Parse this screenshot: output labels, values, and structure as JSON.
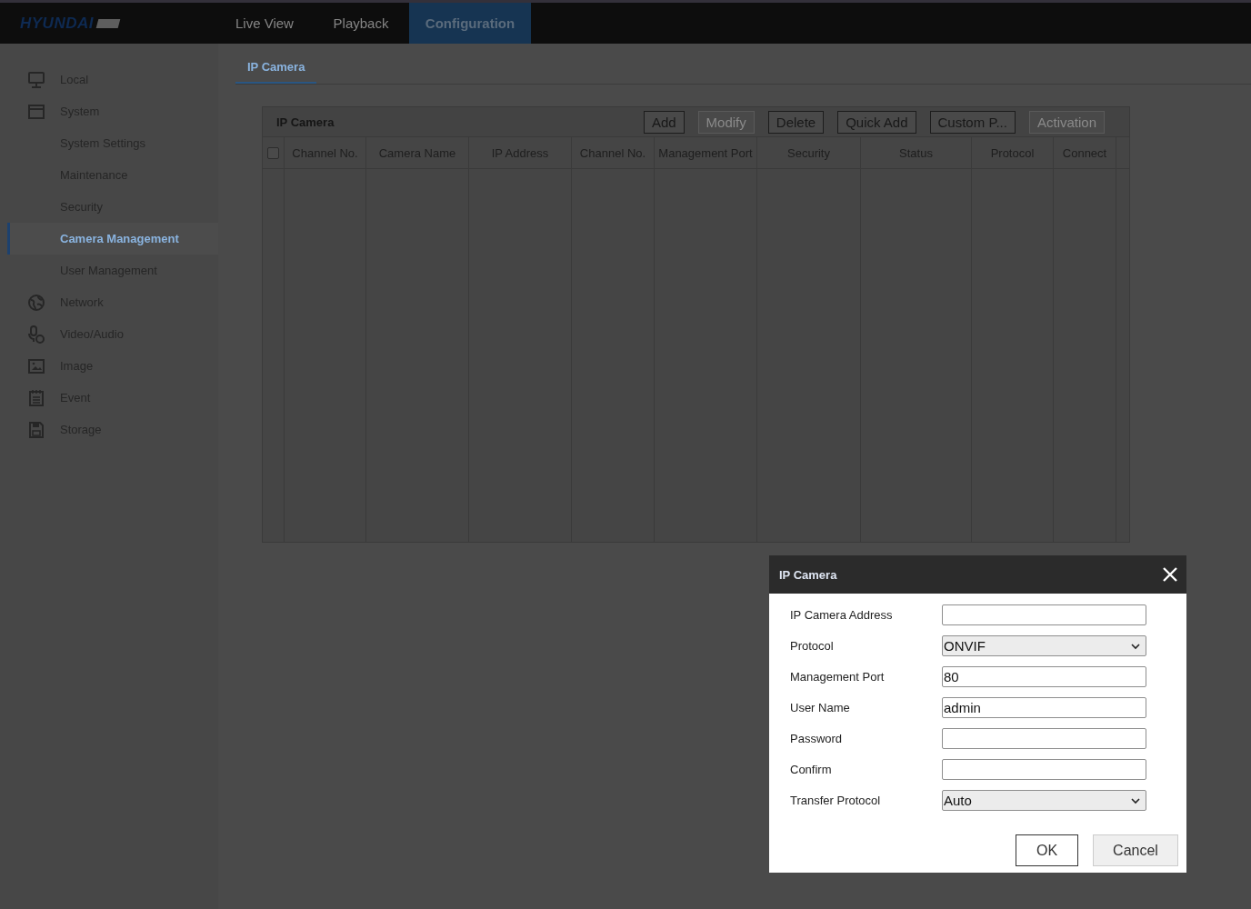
{
  "header": {
    "logo": "HYUNDAI",
    "nav": [
      {
        "label": "Live View",
        "selected": false
      },
      {
        "label": "Playback",
        "selected": false
      },
      {
        "label": "Configuration",
        "selected": true
      }
    ]
  },
  "sidebar": {
    "items": [
      {
        "label": "Local",
        "selected": false
      },
      {
        "label": "System",
        "selected": false,
        "children": [
          {
            "label": "System Settings",
            "selected": false
          },
          {
            "label": "Maintenance",
            "selected": false
          },
          {
            "label": "Security",
            "selected": false
          },
          {
            "label": "Camera Management",
            "selected": true
          },
          {
            "label": "User Management",
            "selected": false
          }
        ]
      },
      {
        "label": "Network",
        "selected": false
      },
      {
        "label": "Video/Audio",
        "selected": false
      },
      {
        "label": "Image",
        "selected": false
      },
      {
        "label": "Event",
        "selected": false
      },
      {
        "label": "Storage",
        "selected": false
      }
    ]
  },
  "tabs": [
    {
      "label": "IP Camera",
      "selected": true
    }
  ],
  "panel": {
    "title": "IP Camera",
    "buttons": [
      {
        "label": "Add",
        "disabled": false
      },
      {
        "label": "Modify",
        "disabled": true
      },
      {
        "label": "Delete",
        "disabled": false
      },
      {
        "label": "Quick Add",
        "disabled": false
      },
      {
        "label": "Custom P...",
        "disabled": false
      },
      {
        "label": "Activation",
        "disabled": true
      }
    ],
    "table": {
      "select_all": {
        "checked": false
      },
      "columns": [
        {
          "label": "Channel No."
        },
        {
          "label": "Camera Name"
        },
        {
          "label": "IP Address"
        },
        {
          "label": "Channel No."
        },
        {
          "label": "Management Port"
        },
        {
          "label": "Security"
        },
        {
          "label": "Status"
        },
        {
          "label": "Protocol"
        },
        {
          "label": "Connect"
        }
      ]
    }
  },
  "dialog": {
    "title": "IP Camera",
    "fields": [
      {
        "label": "IP Camera Address",
        "kind": "text"
      },
      {
        "label": "Protocol",
        "kind": "select",
        "value": "ONVIF"
      },
      {
        "label": "Management Port",
        "kind": "text",
        "value": "80"
      },
      {
        "label": "User Name",
        "kind": "text",
        "value": "admin"
      },
      {
        "label": "Password",
        "kind": "password"
      },
      {
        "label": "Confirm",
        "kind": "password"
      },
      {
        "label": "Transfer Protocol",
        "kind": "select",
        "value": "Auto"
      }
    ],
    "buttons": [
      {
        "label": "OK",
        "kind": "primary"
      },
      {
        "label": "Cancel",
        "kind": "secondary"
      }
    ]
  }
}
